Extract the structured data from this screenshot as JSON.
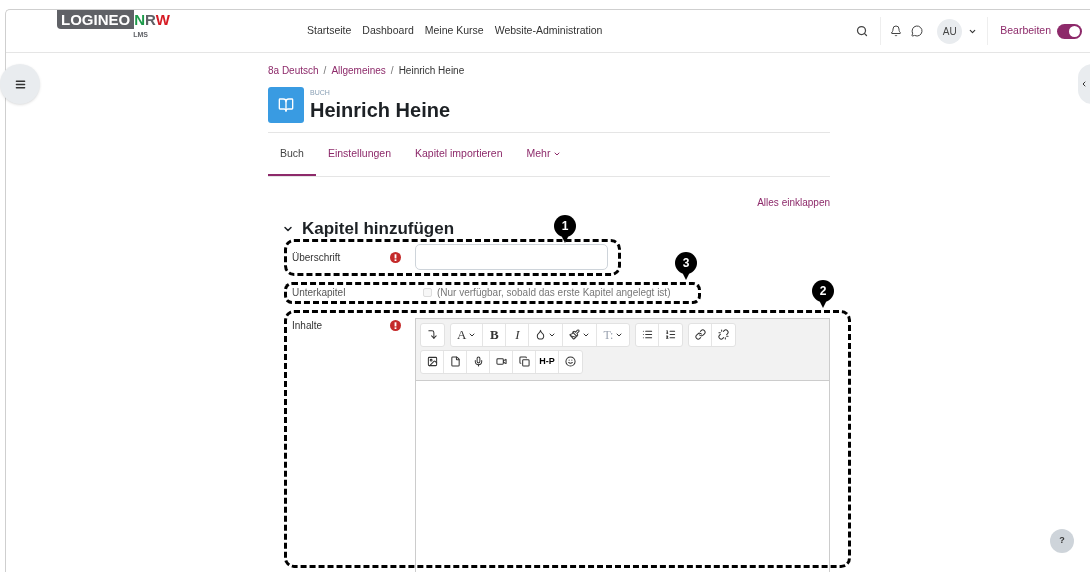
{
  "logo": {
    "word": "LOGINEO",
    "n": "N",
    "r": "R",
    "w": "W",
    "sub": "LMS"
  },
  "nav": [
    "Startseite",
    "Dashboard",
    "Meine Kurse",
    "Website-Administration"
  ],
  "user": {
    "initials": "AU"
  },
  "edit_mode": {
    "label": "Bearbeiten",
    "on": true
  },
  "breadcrumb": [
    {
      "label": "8a Deutsch",
      "current": false
    },
    {
      "separator": "/",
      "label": "Allgemeines",
      "current": false
    },
    {
      "separator": "/",
      "label": "Heinrich Heine",
      "current": true
    }
  ],
  "activity": {
    "type": "BUCH",
    "title": "Heinrich Heine"
  },
  "tabs": [
    {
      "label": "Buch",
      "selected": true,
      "menu": false
    },
    {
      "label": "Einstellungen",
      "selected": false,
      "menu": false
    },
    {
      "label": "Kapitel importieren",
      "selected": false,
      "menu": false
    },
    {
      "label": "Mehr",
      "selected": false,
      "menu": true
    }
  ],
  "collapse_all": "Alles einklappen",
  "section": {
    "title": "Kapitel hinzufügen",
    "expanded": true
  },
  "fields": [
    {
      "kind": "text",
      "label": "Überschrift",
      "required": true,
      "marker": "1"
    },
    {
      "kind": "checkbox",
      "label": "Unterkapitel",
      "checked": false,
      "disabled": true,
      "note": "(Nur verfügbar, sobald das erste Kapitel angelegt ist)",
      "marker": "3"
    },
    {
      "kind": "editor",
      "label": "Inhalte",
      "required": true,
      "marker": "2"
    }
  ],
  "toolbar": [
    [
      [
        {
          "kind": "undo"
        }
      ],
      [
        {
          "kind": "font",
          "label": "A"
        },
        {
          "kind": "bold",
          "label": "B"
        },
        {
          "kind": "italic",
          "label": "I"
        },
        {
          "kind": "color"
        },
        {
          "kind": "brush"
        },
        {
          "kind": "style",
          "label": "T:"
        }
      ],
      [
        {
          "kind": "bullets"
        },
        {
          "kind": "numbers"
        }
      ],
      [
        {
          "kind": "link"
        },
        {
          "kind": "unlink"
        }
      ]
    ],
    [
      [
        {
          "kind": "image"
        },
        {
          "kind": "media"
        },
        {
          "kind": "audio"
        },
        {
          "kind": "video"
        },
        {
          "kind": "copy"
        },
        {
          "kind": "h5p",
          "label": "H-P"
        },
        {
          "kind": "emoji"
        }
      ]
    ]
  ],
  "help": "?"
}
